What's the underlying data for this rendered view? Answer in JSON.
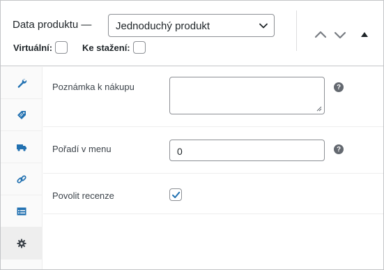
{
  "header": {
    "title": "Data produktu —",
    "product_type": {
      "selected": "Jednoduchý produkt"
    },
    "options": [
      {
        "label": "Virtuální:",
        "checked": false
      },
      {
        "label": "Ke stažení:",
        "checked": false
      }
    ]
  },
  "tabs": [
    {
      "icon": "wrench-icon",
      "label": "Obecné",
      "active": false
    },
    {
      "icon": "tag-icon",
      "label": "Sklad",
      "active": false
    },
    {
      "icon": "truck-icon",
      "label": "Doprava",
      "active": false
    },
    {
      "icon": "link-icon",
      "label": "Propojené produkty",
      "active": false
    },
    {
      "icon": "list-table-icon",
      "label": "Vlastnosti",
      "active": false
    },
    {
      "icon": "gear-icon",
      "label": "Pokročilé",
      "active": true
    }
  ],
  "advanced": {
    "purchase_note": {
      "label": "Poznámka k nákupu",
      "value": ""
    },
    "menu_order": {
      "label": "Pořadí v menu",
      "value": "0"
    },
    "reviews": {
      "label": "Povolit recenze",
      "checked": true
    },
    "help_glyph": "?"
  },
  "colors": {
    "accent": "#2271b1",
    "icon_gray": "#646970",
    "border": "#c3c4c7"
  }
}
